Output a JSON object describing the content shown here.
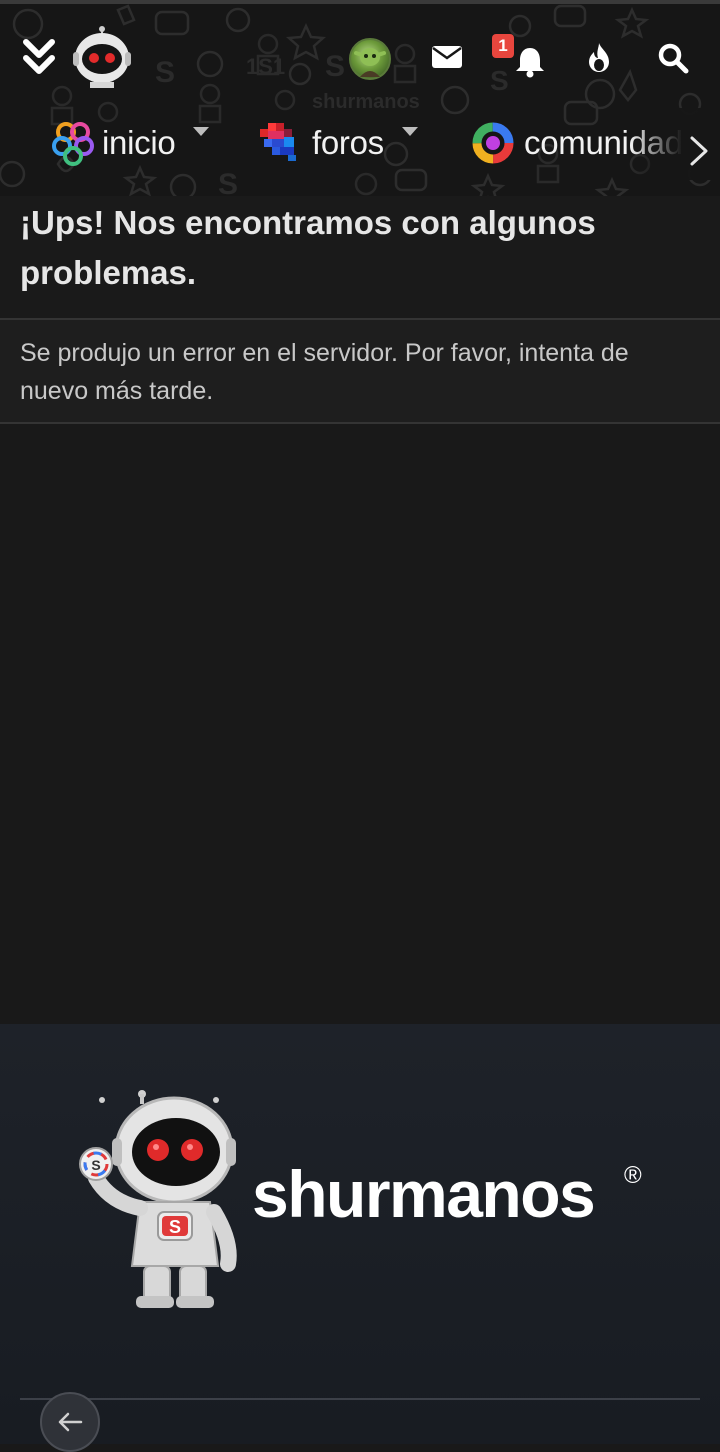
{
  "header": {
    "notifications_count": "1",
    "nav": [
      {
        "label": "inicio"
      },
      {
        "label": "foros"
      },
      {
        "label": "comunidad"
      }
    ]
  },
  "error": {
    "title": "¡Ups! Nos encontramos con algunos problemas.",
    "message": "Se produjo un error en el servidor. Por favor, intenta de nuevo más tarde."
  },
  "footer": {
    "brand": "shurmanos",
    "registered_mark": "®"
  },
  "icons": {
    "menu": "double-chevron-down-icon",
    "logo": "robot-logo-icon",
    "avatar": "user-avatar",
    "messages": "envelope-icon",
    "alerts": "bell-icon",
    "hot": "flame-icon",
    "search": "search-icon",
    "next": "chevron-right-icon",
    "back": "arrow-left-icon"
  },
  "colors": {
    "background": "#191919",
    "header": "#161616",
    "badge": "#e8463e",
    "robot_eyes": "#e32b2b",
    "footer": "#1e2229"
  }
}
